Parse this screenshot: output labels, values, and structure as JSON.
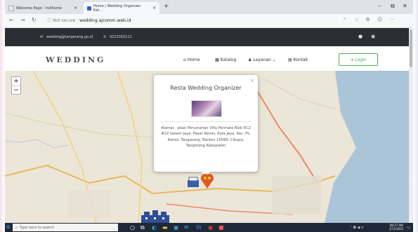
{
  "browser": {
    "tabs": [
      {
        "label": "Welcome Page - Indihome",
        "active": false
      },
      {
        "label": "Home | Wedding Organizer Kat...",
        "active": true
      }
    ],
    "security_label": "Not secure",
    "url": "wedding.ajcomm.web.id",
    "window_controls": [
      "–",
      "⧉",
      "✕"
    ]
  },
  "topbar": {
    "email": "wedding@tangerang.go.id",
    "phone": "0213310111"
  },
  "header": {
    "logo": "WEDDING",
    "menu": [
      {
        "label": "Home",
        "icon": "home-icon"
      },
      {
        "label": "Katalog",
        "icon": "book-icon"
      },
      {
        "label": "Layanan",
        "icon": "users-icon"
      },
      {
        "label": "Kontak",
        "icon": "contact-card-icon"
      }
    ],
    "login_label": "Login"
  },
  "map": {
    "zoom_in": "+",
    "zoom_out": "−",
    "popup": {
      "title": "Resta Wedding Organizer",
      "close": "×",
      "address": "Alamat : Jalan Perumahan Villa Permata Blok EC2 #22 Gelam Jaya, Pasar Kemis, Kota Jaya, Kec. Ps. Kemis, Tangerang, Banten 15560, Cikupa, Tangerang Kabupaten"
    }
  },
  "taskbar": {
    "search_placeholder": "Type here to search",
    "time": "08:27 AM",
    "date": "2/11/2021"
  },
  "colors": {
    "topbar_bg": "#2b2e33",
    "login_accent": "#4caf50",
    "marker": "#e05a1e",
    "taskbar_bg": "#1f2836"
  }
}
